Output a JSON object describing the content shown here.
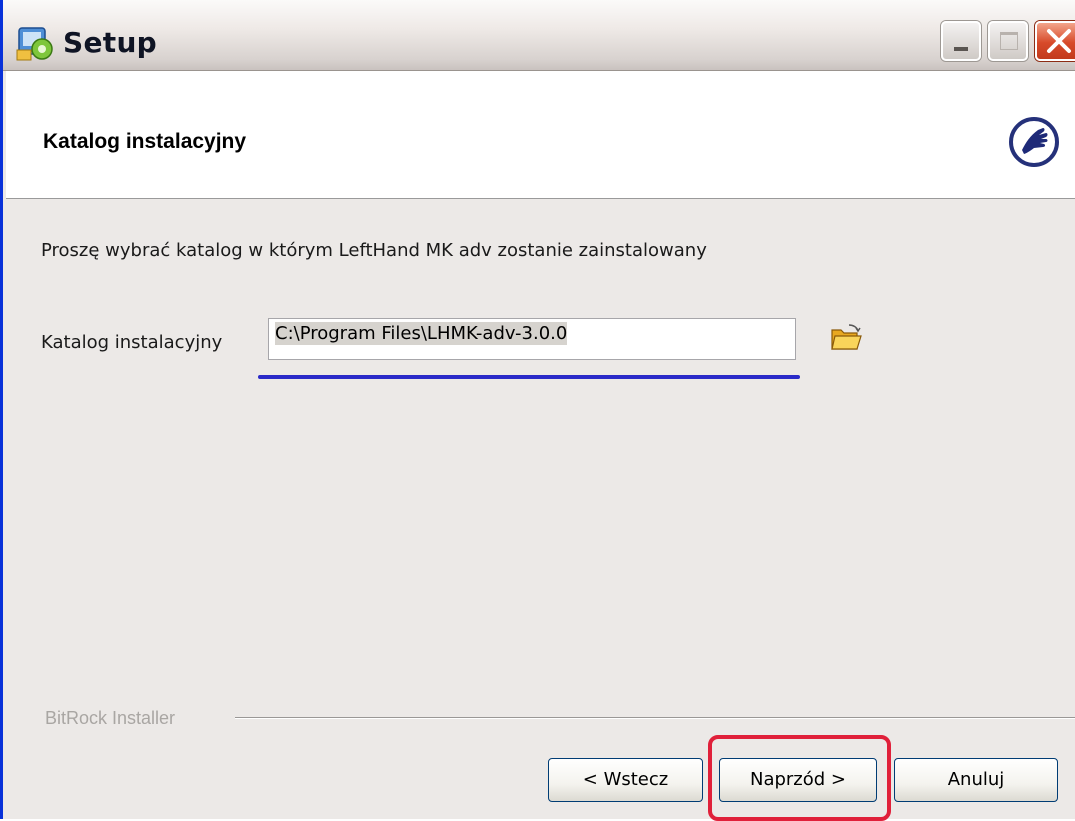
{
  "window": {
    "title": "Setup",
    "controls": [
      "minimize",
      "maximize",
      "close"
    ]
  },
  "header": {
    "title": "Katalog instalacyjny",
    "logo_icon": "pointing-hand-icon"
  },
  "body": {
    "instruction": "Proszę wybrać katalog w którym  LeftHand MK adv zostanie zainstalowany",
    "directory_label": "Katalog instalacyjny",
    "directory_value": "C:\\Program Files\\LHMK-adv-3.0.0",
    "browse_icon": "folder-open-icon"
  },
  "footer": {
    "brand": "BitRock Installer",
    "back_label": "< Wstecz",
    "next_label": "Naprzód >",
    "cancel_label": "Anuluj"
  },
  "colors": {
    "annotation_underline": "#2a2ac8",
    "annotation_highlight": "#e0203a",
    "window_border": "#0831d9"
  }
}
